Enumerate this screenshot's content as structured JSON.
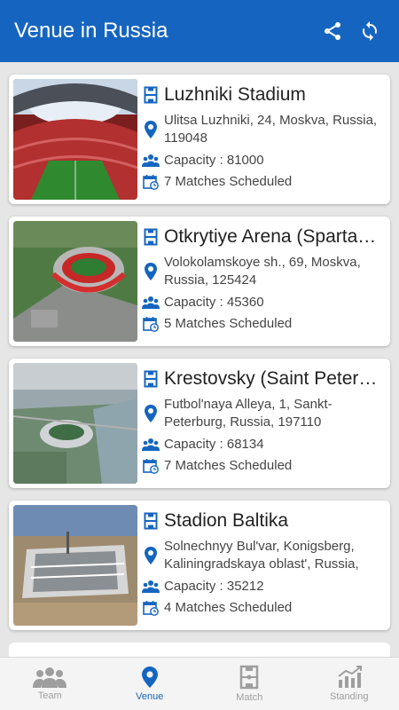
{
  "appbar": {
    "title": "Venue in Russia",
    "share_icon": "share-icon",
    "refresh_icon": "refresh-icon"
  },
  "colors": {
    "primary": "#1565c0",
    "icon_blue": "#1565c0",
    "tab_inactive": "#9e9e9e"
  },
  "venues": [
    {
      "name": "Luzhniki Stadium",
      "address": "Ulitsa Luzhniki, 24, Moskva, Russia, 119048",
      "capacity": "Capacity : 81000",
      "matches": "7 Matches Scheduled"
    },
    {
      "name": "Otkrytiye Arena (Sparta…",
      "address": "Volokolamskoye sh., 69, Moskva, Russia, 125424",
      "capacity": "Capacity : 45360",
      "matches": "5 Matches Scheduled"
    },
    {
      "name": "Krestovsky (Saint Peters…",
      "address": "Futbol'naya Alleya, 1, Sankt-Peterburg, Russia, 197110",
      "capacity": "Capacity : 68134",
      "matches": "7 Matches Scheduled"
    },
    {
      "name": "Stadion Baltika",
      "address": "Solnechnyy Bul'var, Konigsberg, Kaliningradskaya oblast', Russia,",
      "capacity": "Capacity : 35212",
      "matches": "4 Matches Scheduled"
    }
  ],
  "tabs": [
    {
      "label": "Team",
      "icon": "team-icon",
      "active": false
    },
    {
      "label": "Venue",
      "icon": "location-pin-icon",
      "active": true
    },
    {
      "label": "Match",
      "icon": "football-pitch-icon",
      "active": false
    },
    {
      "label": "Standing",
      "icon": "bar-chart-icon",
      "active": false
    }
  ]
}
